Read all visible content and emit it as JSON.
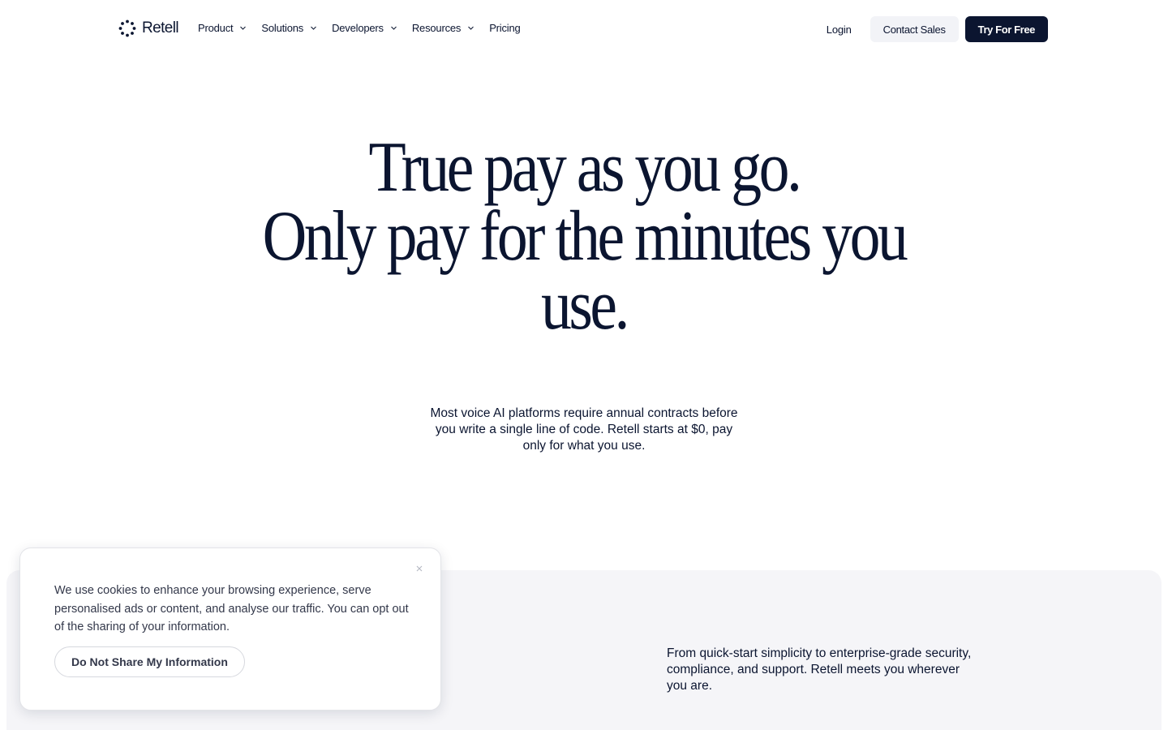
{
  "nav": {
    "logo_text": "Retell",
    "menu": [
      {
        "label": "Product",
        "has_dropdown": true
      },
      {
        "label": "Solutions",
        "has_dropdown": true
      },
      {
        "label": "Developers",
        "has_dropdown": true
      },
      {
        "label": "Resources",
        "has_dropdown": true
      },
      {
        "label": "Pricing",
        "has_dropdown": false
      }
    ],
    "login": "Login",
    "contact_sales": "Contact Sales",
    "try_for_free": "Try For Free"
  },
  "hero": {
    "title_line1": "True pay as you go.",
    "title_line2": "Only pay for the minutes you",
    "title_line3": "use.",
    "subtitle": "Most voice AI platforms require annual contracts before you write a single line of code. Retell starts at $0, pay only for what you use."
  },
  "section": {
    "text": "From quick-start simplicity to enterprise-grade security, compliance, and support. Retell meets you wherever you are."
  },
  "cookie": {
    "text": "We use cookies to enhance your browsing experience, serve personalised ads or content, and analyse our traffic. You can opt out of the sharing of your information.",
    "button": "Do Not Share My Information"
  },
  "colors": {
    "brand_navy": "#0b1530",
    "section_bg": "#f5f5f8",
    "contact_bg": "#f2f3f7"
  },
  "icons": [
    "retell-logo-icon",
    "chevron-down-icon",
    "close-icon"
  ]
}
